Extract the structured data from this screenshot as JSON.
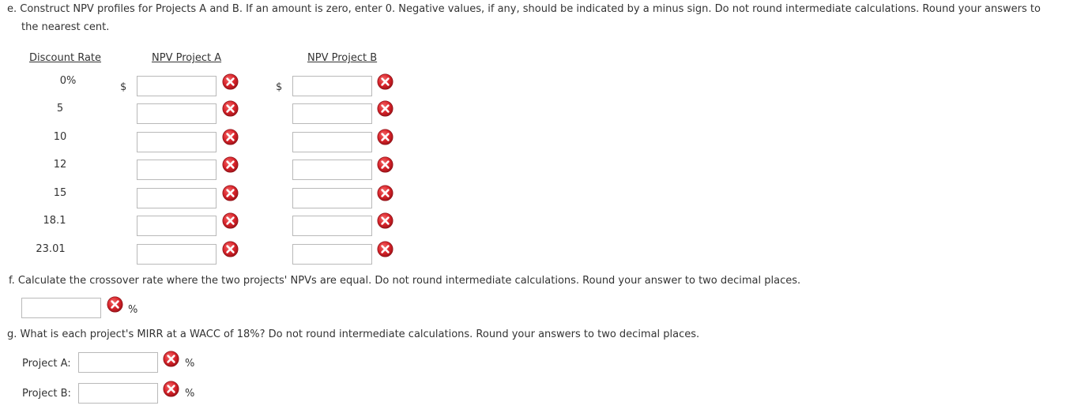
{
  "part_e": {
    "prompt_line1": "e. Construct NPV profiles for Projects A and B. If an amount is zero, enter 0. Negative values, if any, should be indicated by a minus sign. Do not round intermediate calculations. Round your answers to",
    "prompt_line2": "the nearest cent.",
    "headers": {
      "discount_rate": "Discount Rate",
      "npv_a": "NPV Project A",
      "npv_b": "NPV Project B"
    },
    "currency_symbol": "$",
    "rows": [
      {
        "rate": "0%",
        "npv_a": "",
        "npv_b": ""
      },
      {
        "rate": "5",
        "npv_a": "",
        "npv_b": ""
      },
      {
        "rate": "10",
        "npv_a": "",
        "npv_b": ""
      },
      {
        "rate": "12",
        "npv_a": "",
        "npv_b": ""
      },
      {
        "rate": "15",
        "npv_a": "",
        "npv_b": ""
      },
      {
        "rate": "18.1",
        "npv_a": "",
        "npv_b": ""
      },
      {
        "rate": "23.01",
        "npv_a": "",
        "npv_b": ""
      }
    ]
  },
  "part_f": {
    "prompt": "f. Calculate the crossover rate where the two projects' NPVs are equal. Do not round intermediate calculations. Round your answer to two decimal places.",
    "value": "",
    "unit": "%"
  },
  "part_g": {
    "prompt": "g. What is each project's MIRR at a WACC of 18%? Do not round intermediate calculations. Round your answers to two decimal places.",
    "project_a_label": "Project A:",
    "project_a_value": "",
    "project_b_label": "Project B:",
    "project_b_value": "",
    "unit": "%"
  },
  "icons": {
    "incorrect_mark": "wrong-answer-icon"
  },
  "colors": {
    "incorrect_red": "#d9242b",
    "input_border": "#b9b9b9",
    "text": "#333333"
  }
}
